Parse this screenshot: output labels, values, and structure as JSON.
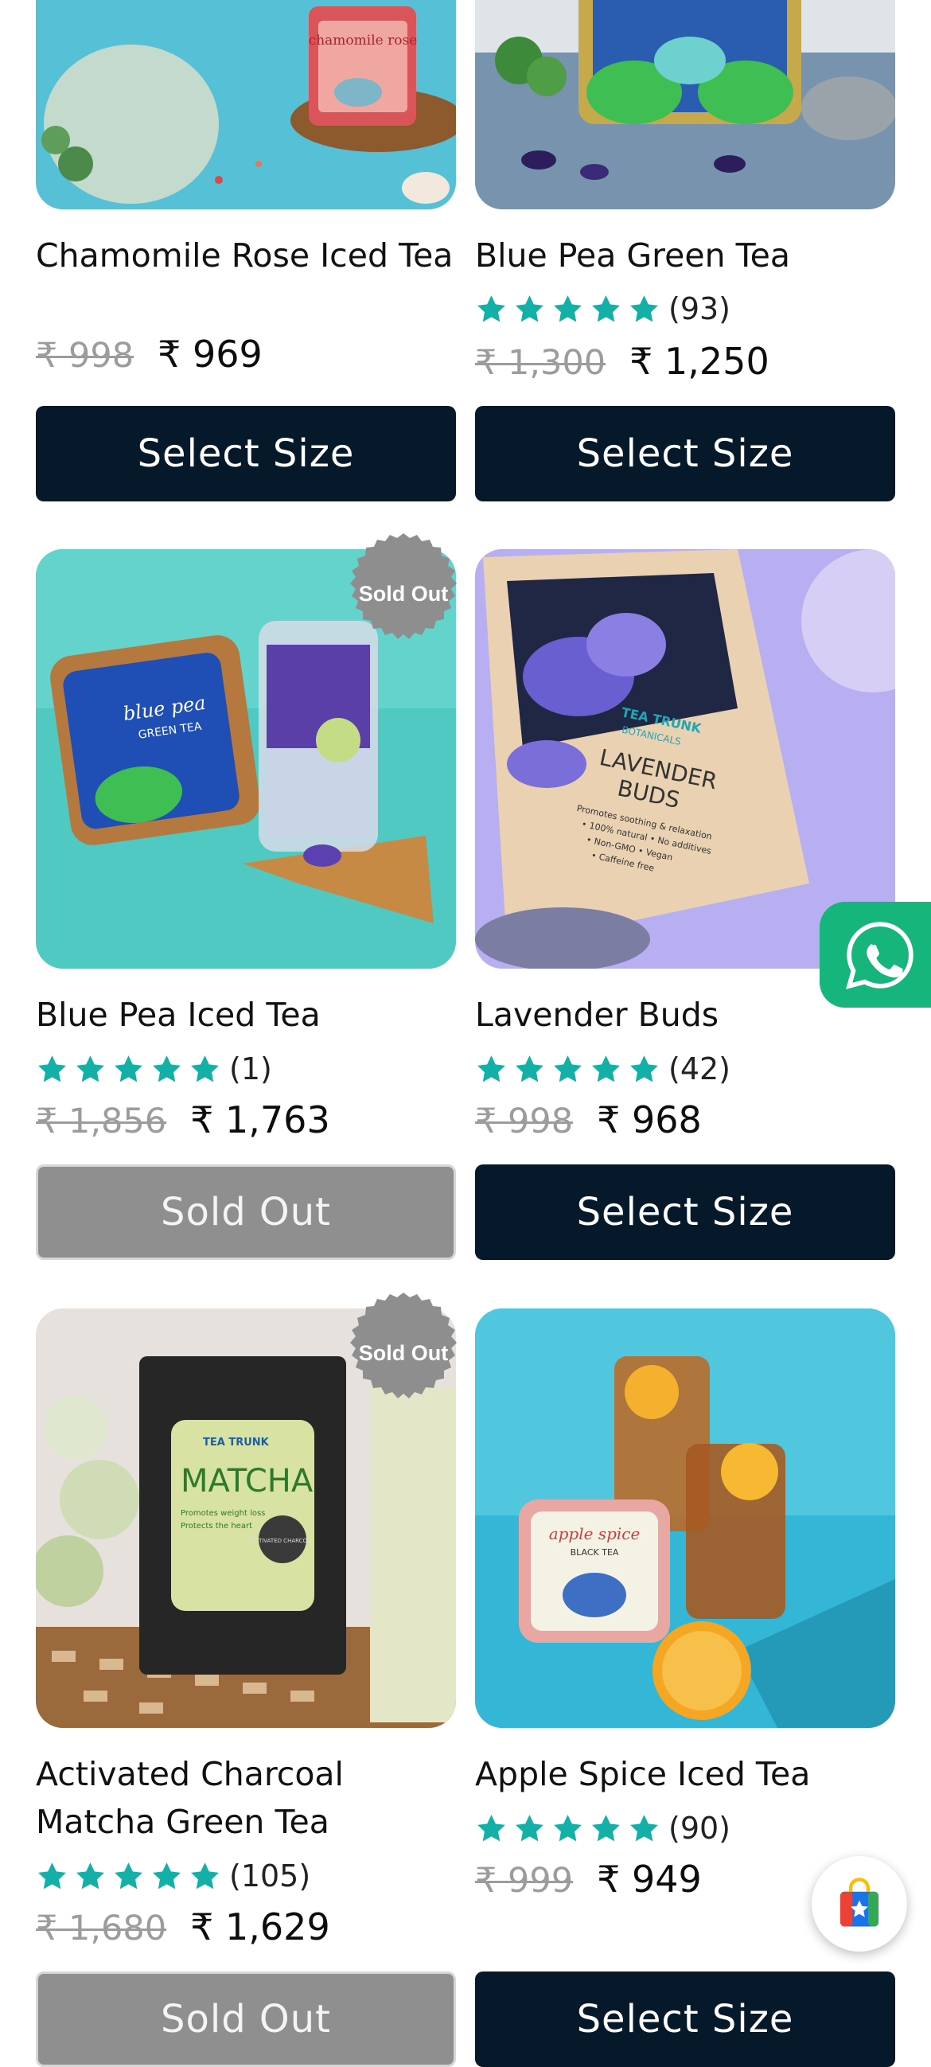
{
  "products": [
    {
      "name": "Chamomile Rose Iced Tea",
      "old_price": "₹ 998",
      "price": "₹ 969",
      "button": "Select Size",
      "has_rating": false
    },
    {
      "name": "Blue Pea Green Tea",
      "rating_count": "(93)",
      "stars": 5,
      "old_price": "₹ 1,300",
      "price": "₹ 1,250",
      "button": "Select Size",
      "has_rating": true
    },
    {
      "name": "Blue Pea Iced Tea",
      "rating_count": "(1)",
      "stars": 5,
      "old_price": "₹ 1,856",
      "price": "₹ 1,763",
      "button": "Sold Out",
      "badge": "Sold Out",
      "has_rating": true
    },
    {
      "name": "Lavender Buds",
      "rating_count": "(42)",
      "stars": 5,
      "old_price": "₹ 998",
      "price": "₹ 968",
      "button": "Select Size",
      "has_rating": true
    },
    {
      "name": "Activated Charcoal Matcha Green Tea",
      "rating_count": "(105)",
      "stars": 5,
      "old_price": "₹ 1,680",
      "price": "₹ 1,629",
      "button": "Sold Out",
      "badge": "Sold Out",
      "has_rating": true
    },
    {
      "name": "Apple Spice Iced Tea",
      "rating_count": "(90)",
      "stars": 5,
      "old_price": "₹ 999",
      "price": "₹ 949",
      "button": "Select Size",
      "has_rating": true
    }
  ],
  "image_text": {
    "chamomile_tin": "chamomile rose",
    "bluepea_tin_line1": "blue pea",
    "bluepea_tin_line2": "GREEN TEA",
    "lavender_brand": "TEA TRUNK",
    "lavender_brand2": "BOTANICALS",
    "lavender_title1": "LAVENDER",
    "lavender_title2": "BUDS",
    "lavender_bullet1": "Promotes soothing & relaxation",
    "lavender_bullet2": "• 100% natural • No additives",
    "lavender_bullet3": "• Non-GMO • Vegan",
    "lavender_bullet4": "• Caffeine free",
    "matcha_brand": "TEA TRUNK",
    "matcha_title": "MATCHA",
    "matcha_line1": "Promotes weight loss",
    "matcha_line2": "Protects the heart",
    "matcha_seal": "ACTIVATED CHARCOAL",
    "apple_tin1": "apple spice",
    "apple_tin2": "BLACK TEA"
  },
  "colors": {
    "star": "#13b0a8",
    "button_dark": "#06192b",
    "sold_out_gray": "#8f8f8f",
    "whatsapp_green": "#16b57c"
  },
  "icons": {
    "whatsapp": "whatsapp-icon",
    "store": "shopping-bag-star-icon",
    "star": "star-icon"
  }
}
